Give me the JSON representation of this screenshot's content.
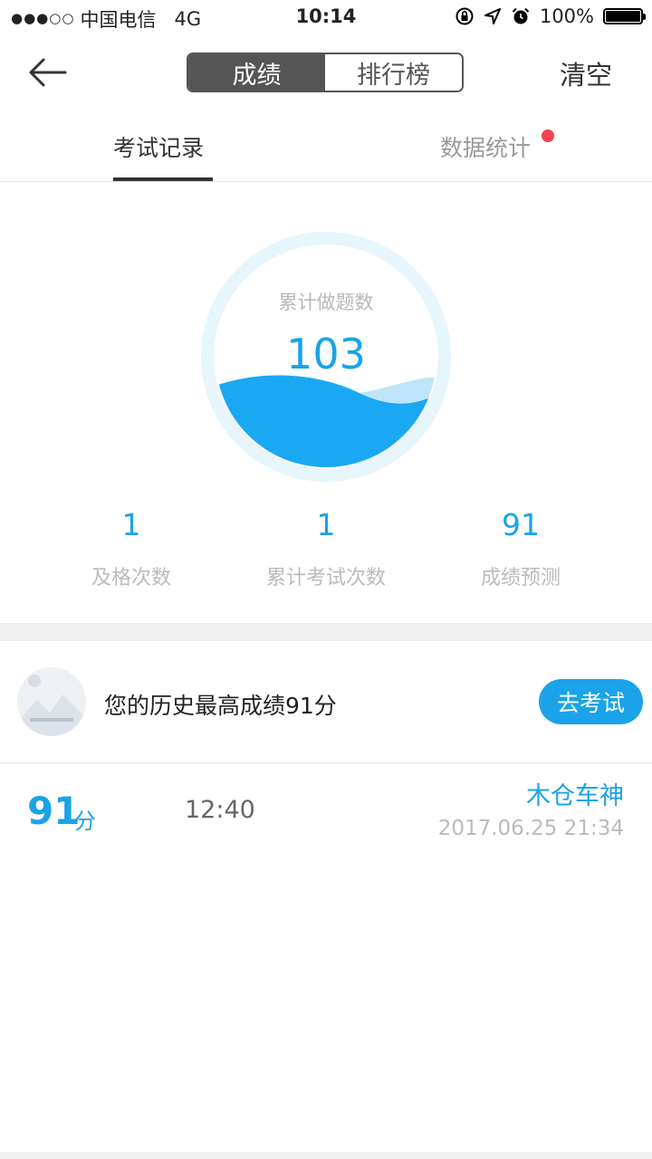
{
  "status": {
    "dots": "●●●○○",
    "carrier": "中国电信",
    "network": "4G",
    "time": "10:14",
    "battery": "100%"
  },
  "nav": {
    "segments": [
      "成绩",
      "排行榜"
    ],
    "clear": "清空"
  },
  "tabs": [
    "考试记录",
    "数据统计"
  ],
  "gauge": {
    "label": "累计做题数",
    "value": "103",
    "fill_fraction": 0.38
  },
  "stats": [
    {
      "value": "1",
      "label": "及格次数"
    },
    {
      "value": "1",
      "label": "累计考试次数"
    },
    {
      "value": "91",
      "label": "成绩预测"
    }
  ],
  "best": {
    "text": "您的历史最高成绩91分",
    "button": "去考试"
  },
  "record": {
    "score": "91",
    "unit": "分",
    "duration": "12:40",
    "rank": "木仓车神",
    "date": "2017.06.25 21:34"
  },
  "colors": {
    "accent": "#1aa3e8",
    "water": "#1ba8f2",
    "ring": "#e7f5fd",
    "badge": "#f0444c"
  }
}
